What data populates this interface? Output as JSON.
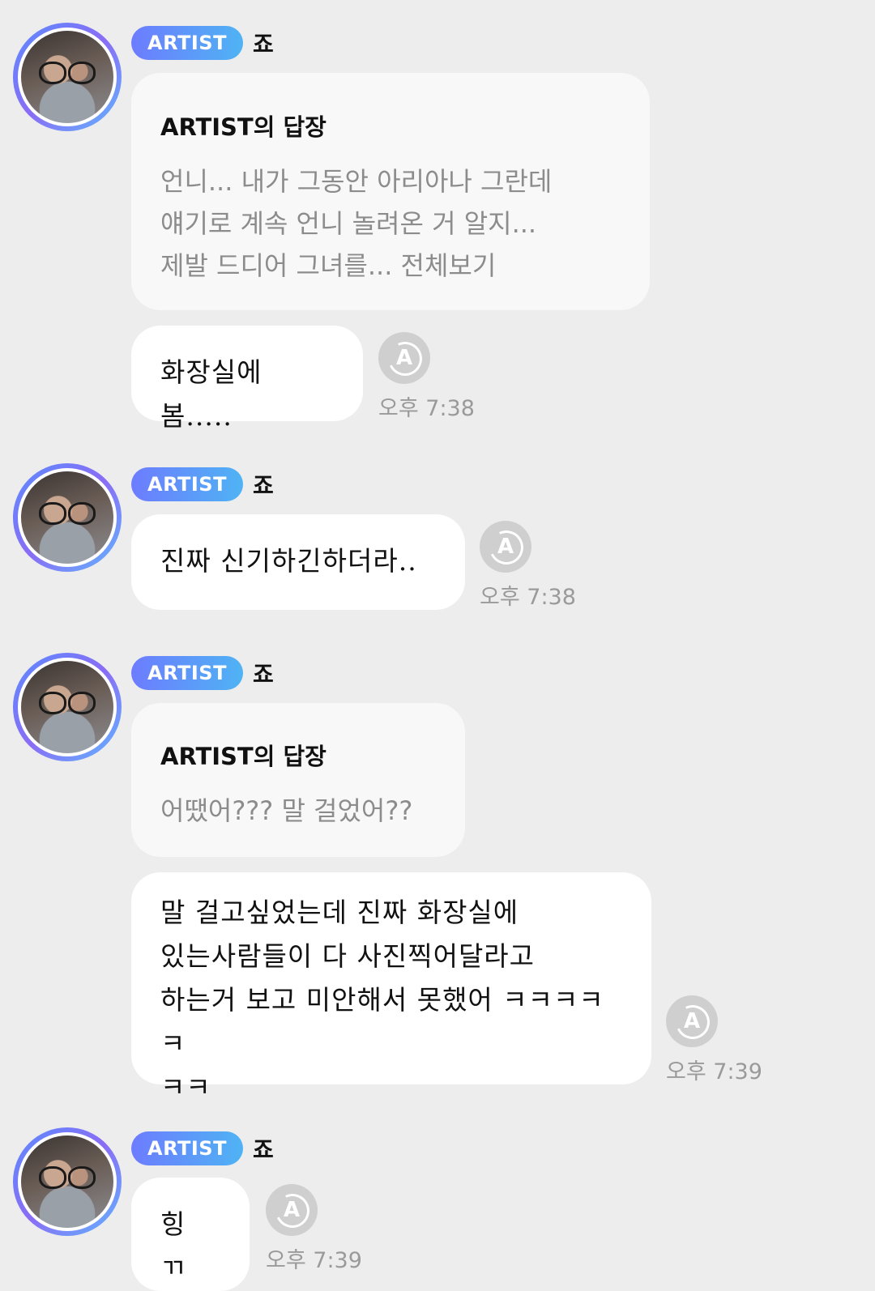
{
  "messages": [
    {
      "badge": "ARTIST",
      "name": "죠",
      "reply_title": "ARTIST의 답장",
      "reply_lines": [
        "언니... 내가 그동안 아리아나 그란데",
        "얘기로 계속 언니 놀려온 거 알지...",
        "제발 드디어 그녀를... 전체보기"
      ],
      "text_lines": [
        "화장실에 봄....."
      ],
      "time": "오후 7:38"
    },
    {
      "badge": "ARTIST",
      "name": "죠",
      "text_lines": [
        "진짜 신기하긴하더라.."
      ],
      "time": "오후 7:38"
    },
    {
      "badge": "ARTIST",
      "name": "죠",
      "reply_title": "ARTIST의 답장",
      "reply_lines": [
        "어땠어??? 말 걸었어??"
      ],
      "text_lines": [
        "말 걸고싶었는데 진짜 화장실에",
        "있는사람들이 다 사진찍어달라고",
        "하는거 보고 미안해서 못했어 ㅋㅋㅋㅋㅋ",
        "ㅋㅋ"
      ],
      "time": "오후 7:39"
    },
    {
      "badge": "ARTIST",
      "name": "죠",
      "text_lines": [
        "힝 ㄲ"
      ],
      "time": "오후 7:39"
    }
  ],
  "icons": {
    "translate": "A"
  },
  "colors": {
    "badge_start": "#6d7cff",
    "badge_end": "#4fb3f4",
    "background": "#ededed"
  }
}
